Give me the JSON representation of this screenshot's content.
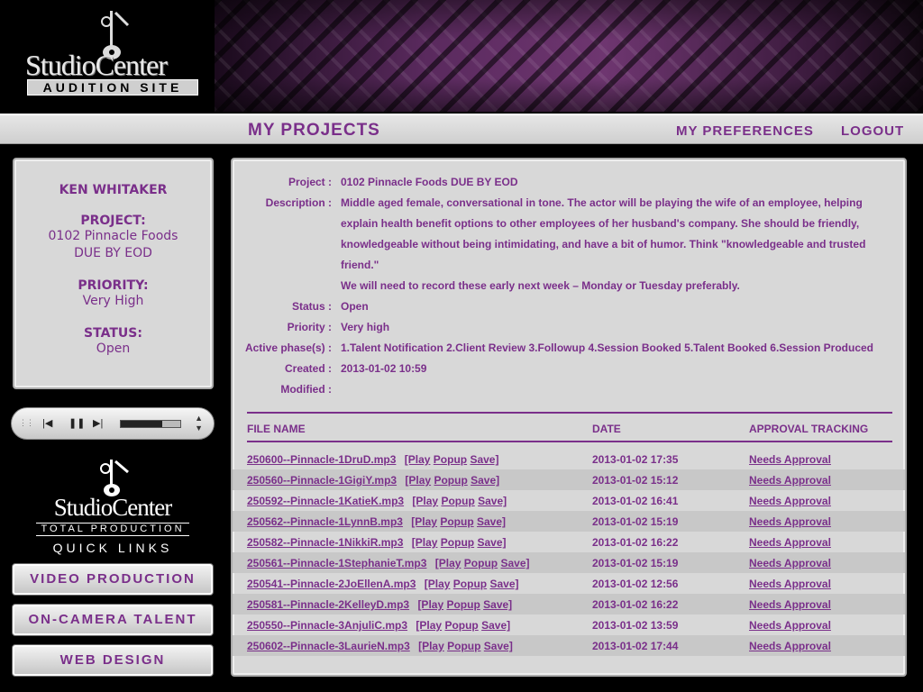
{
  "header": {
    "logo_text": "StudioCenter",
    "logo_sub": "AUDITION SITE"
  },
  "nav": {
    "title": "MY PROJECTS",
    "preferences": "MY PREFERENCES",
    "logout": "LOGOUT"
  },
  "sidebar": {
    "user_name": "KEN WHITAKER",
    "project_label": "PROJECT:",
    "project_line1": "0102 Pinnacle Foods",
    "project_line2": "DUE BY EOD",
    "priority_label": "PRIORITY:",
    "priority_value": "Very High",
    "status_label": "STATUS:",
    "status_value": "Open"
  },
  "player": {
    "progress": 0.3
  },
  "quicklinks": {
    "logo_text": "StudioCenter",
    "logo_sub": "TOTAL PRODUCTION",
    "title": "QUICK LINKS",
    "buttons": [
      "VIDEO PRODUCTION",
      "ON-CAMERA TALENT",
      "WEB DESIGN"
    ]
  },
  "details": {
    "project_label": "Project :",
    "project": "0102 Pinnacle Foods DUE BY EOD",
    "description_label": "Description :",
    "description_lines": [
      "Middle aged female, conversational in tone. The actor will be playing the wife of an employee, helping",
      "explain health benefit options to other employees of her husband's company. She should be friendly,",
      "knowledgeable without being intimidating, and have a bit of humor. Think \"knowledgeable and trusted",
      "friend.\"",
      "We will need to record these early next week – Monday or Tuesday preferably."
    ],
    "status_label": "Status :",
    "status": "Open",
    "priority_label": "Priority :",
    "priority": "Very high",
    "phases_label": "Active phase(s) :",
    "phases": "1.Talent Notification 2.Client Review 3.Followup 4.Session Booked 5.Talent Booked 6.Session Produced",
    "created_label": "Created :",
    "created": "2013-01-02 10:59",
    "modified_label": "Modified :",
    "modified": ""
  },
  "table": {
    "headers": [
      "FILE NAME",
      "DATE",
      "APPROVAL TRACKING"
    ],
    "action_open": "[Play",
    "action_popup": "Popup",
    "action_save": "Save]",
    "rows": [
      {
        "file": "250600--Pinnacle-1DruD.mp3",
        "date": "2013-01-02 17:35",
        "approval": "Needs Approval"
      },
      {
        "file": "250560--Pinnacle-1GigiY.mp3",
        "date": "2013-01-02 15:12",
        "approval": "Needs Approval"
      },
      {
        "file": "250592--Pinnacle-1KatieK.mp3",
        "date": "2013-01-02 16:41",
        "approval": "Needs Approval"
      },
      {
        "file": "250562--Pinnacle-1LynnB.mp3",
        "date": "2013-01-02 15:19",
        "approval": "Needs Approval"
      },
      {
        "file": "250582--Pinnacle-1NikkiR.mp3",
        "date": "2013-01-02 16:22",
        "approval": "Needs Approval"
      },
      {
        "file": "250561--Pinnacle-1StephanieT.mp3",
        "date": "2013-01-02 15:19",
        "approval": "Needs Approval"
      },
      {
        "file": "250541--Pinnacle-2JoEllenA.mp3",
        "date": "2013-01-02 12:56",
        "approval": "Needs Approval"
      },
      {
        "file": "250581--Pinnacle-2KelleyD.mp3",
        "date": "2013-01-02 16:22",
        "approval": "Needs Approval"
      },
      {
        "file": "250550--Pinnacle-3AnjuliC.mp3",
        "date": "2013-01-02 13:59",
        "approval": "Needs Approval"
      },
      {
        "file": "250602--Pinnacle-3LaurieN.mp3",
        "date": "2013-01-02 17:44",
        "approval": "Needs Approval"
      }
    ]
  }
}
